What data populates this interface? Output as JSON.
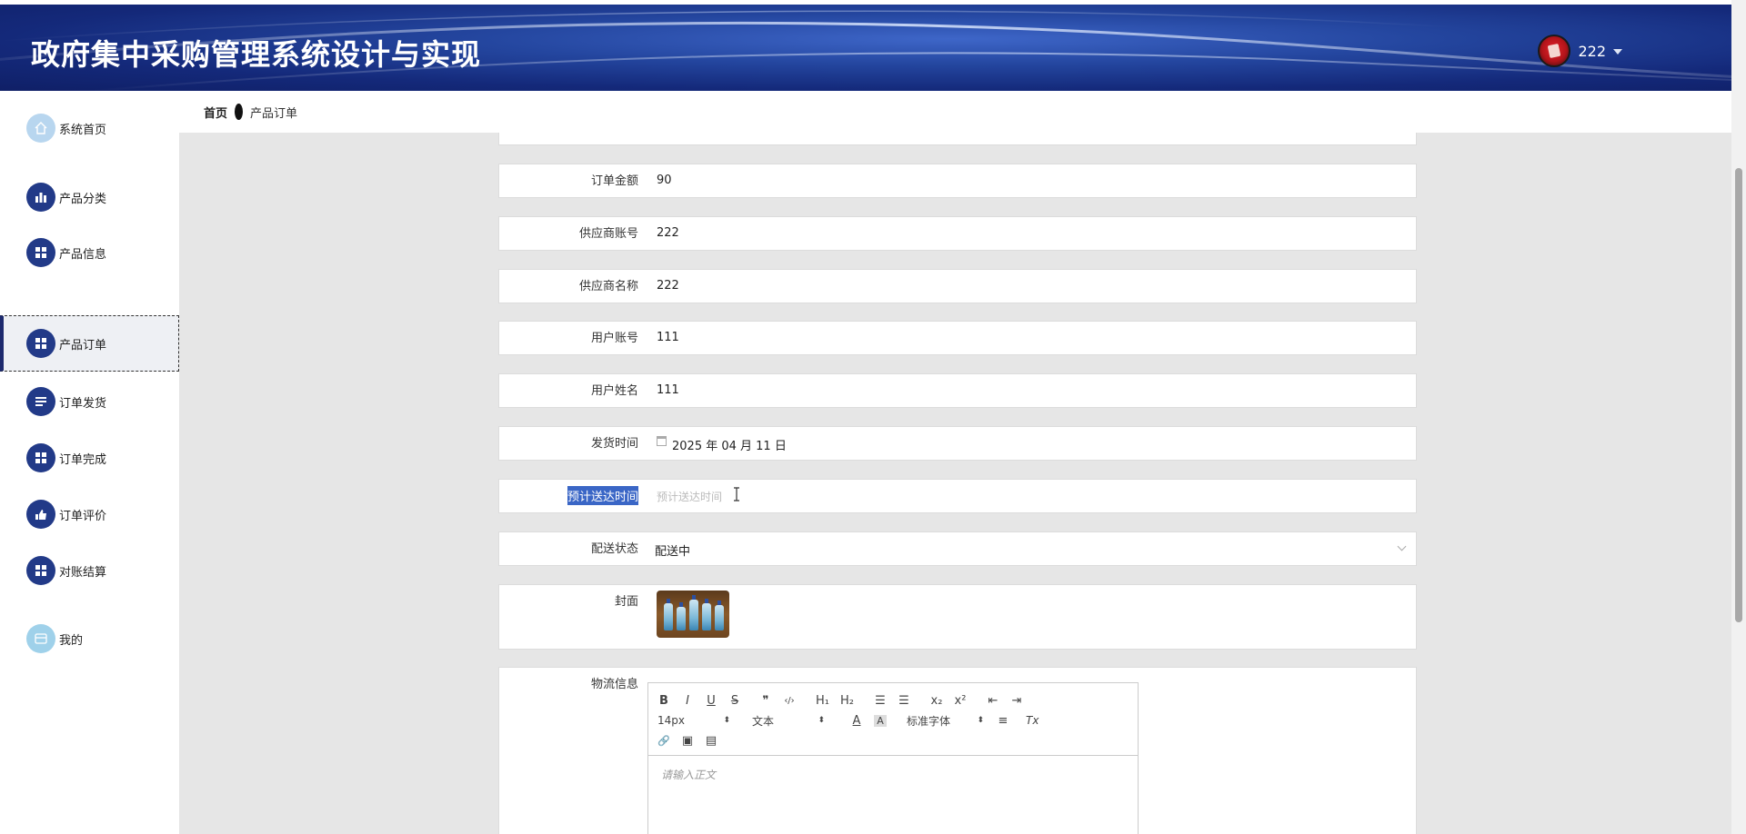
{
  "header": {
    "title": "政府集中采购管理系统设计与实现",
    "username": "222"
  },
  "breadcrumb": {
    "home": "首页",
    "current": "产品订单"
  },
  "sidebar": {
    "items": [
      {
        "label": "系统首页",
        "icon": "home-icon"
      },
      {
        "label": "产品分类",
        "icon": "bar-chart-icon"
      },
      {
        "label": "产品信息",
        "icon": "grid-icon"
      },
      {
        "label": "产品订单",
        "icon": "grid-icon",
        "active": true
      },
      {
        "label": "订单发货",
        "icon": "list-icon"
      },
      {
        "label": "订单完成",
        "icon": "grid-icon"
      },
      {
        "label": "订单评价",
        "icon": "thumb-icon"
      },
      {
        "label": "对账结算",
        "icon": "grid-icon"
      },
      {
        "label": "我的",
        "icon": "profile-icon"
      }
    ]
  },
  "form": {
    "order_amount": {
      "label": "订单金额",
      "value": "90"
    },
    "supplier_account": {
      "label": "供应商账号",
      "value": "222"
    },
    "supplier_name": {
      "label": "供应商名称",
      "value": "222"
    },
    "user_account": {
      "label": "用户账号",
      "value": "111"
    },
    "user_name": {
      "label": "用户姓名",
      "value": "111"
    },
    "ship_time": {
      "label": "发货时间",
      "value": "2025 年 04 月 11 日"
    },
    "eta": {
      "label": "预计送达时间",
      "placeholder": "预计送达时间"
    },
    "delivery_status": {
      "label": "配送状态",
      "value": "配送中"
    },
    "cover": {
      "label": "封面"
    },
    "logistics": {
      "label": "物流信息"
    }
  },
  "editor": {
    "font_size": "14px",
    "text_type": "文本",
    "font_family": "标准字体",
    "placeholder": "请输入正文",
    "buttons": {
      "bold": "B",
      "italic": "I",
      "underline": "U",
      "strike": "S",
      "quote": "❞",
      "code": "‹/›",
      "h1": "H₁",
      "h2": "H₂",
      "ordered_list": "☰",
      "bullet_list": "☰",
      "subscript": "x₂",
      "superscript": "x²",
      "outdent": "⇤",
      "indent": "⇥",
      "color": "A",
      "background": "A",
      "align": "≡",
      "clear": "Tx",
      "link": "🔗",
      "image": "▣",
      "video": "▤"
    }
  },
  "colors": {
    "header_blue": "#1d3a8f",
    "nav_icon": "#223a88",
    "selection": "#3a66c6"
  }
}
